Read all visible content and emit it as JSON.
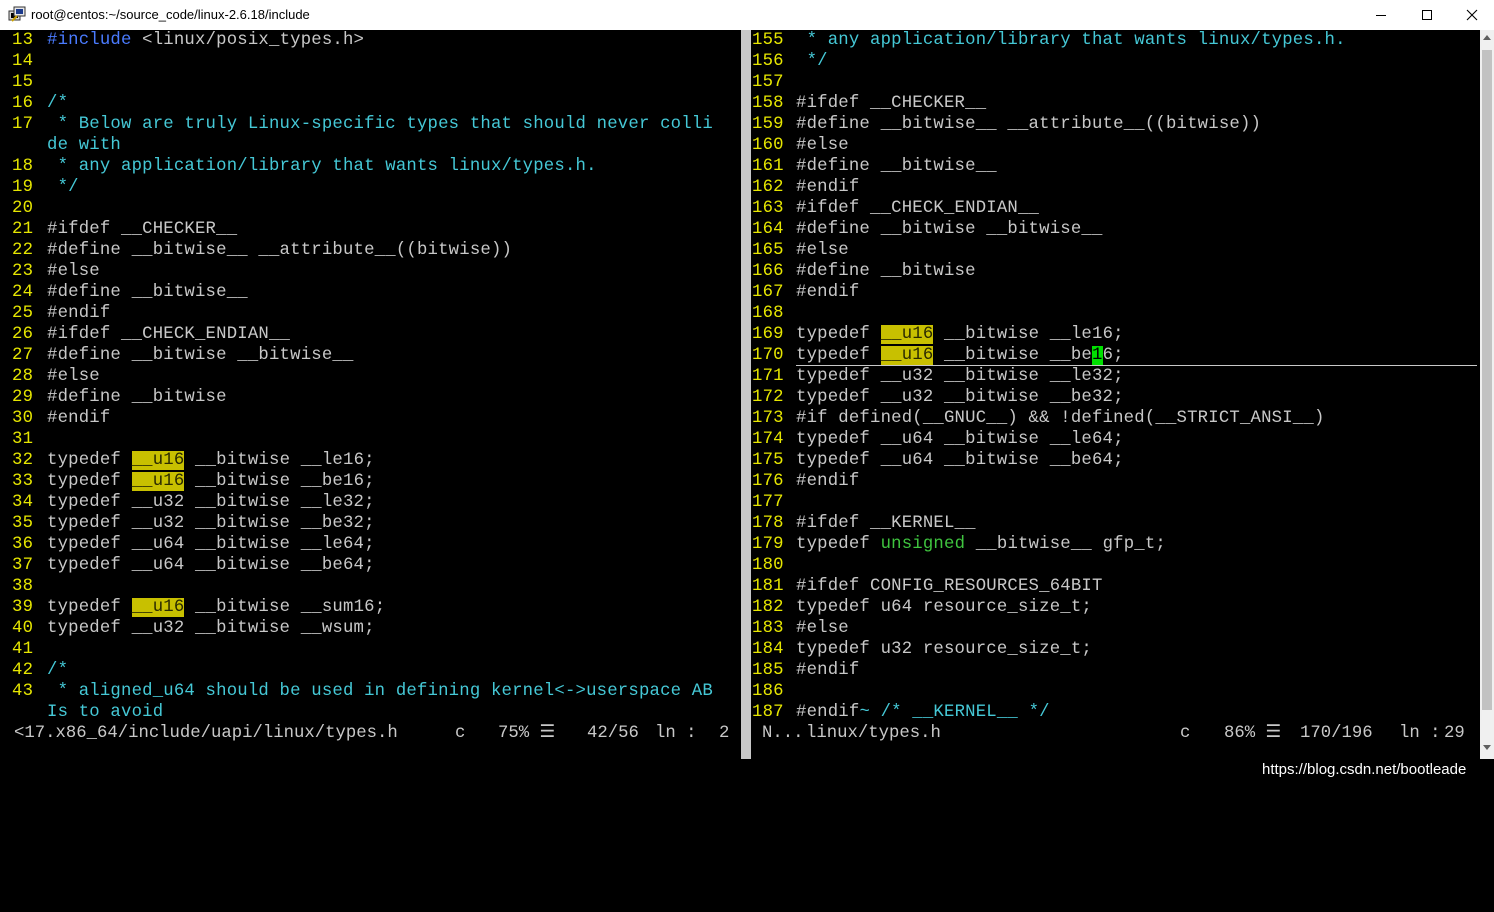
{
  "window": {
    "title": "root@centos:~/source_code/linux-2.6.18/include",
    "icons": [
      "putty-icon",
      "minimize-icon",
      "maximize-icon",
      "close-icon"
    ]
  },
  "left_pane": {
    "lines": [
      {
        "n": "13",
        "parts": [
          {
            "t": "#include",
            "c": "inc"
          },
          {
            "t": " <linux/posix_types.h>",
            "c": "norm"
          }
        ]
      },
      {
        "n": "14",
        "parts": []
      },
      {
        "n": "15",
        "parts": []
      },
      {
        "n": "16",
        "parts": [
          {
            "t": "/*",
            "c": "cmt"
          }
        ]
      },
      {
        "n": "17",
        "parts": [
          {
            "t": " * Below are truly Linux-specific types that should never colli",
            "c": "cmt"
          }
        ]
      },
      {
        "n": "",
        "parts": [
          {
            "t": "de with",
            "c": "cmt"
          }
        ]
      },
      {
        "n": "18",
        "parts": [
          {
            "t": " * any application/library that wants linux/types.h.",
            "c": "cmt"
          }
        ]
      },
      {
        "n": "19",
        "parts": [
          {
            "t": " */",
            "c": "cmt"
          }
        ]
      },
      {
        "n": "20",
        "parts": []
      },
      {
        "n": "21",
        "parts": [
          {
            "t": "#ifdef __CHECKER__",
            "c": "norm"
          }
        ]
      },
      {
        "n": "22",
        "parts": [
          {
            "t": "#define __bitwise__ __attribute__((bitwise))",
            "c": "norm"
          }
        ]
      },
      {
        "n": "23",
        "parts": [
          {
            "t": "#else",
            "c": "norm"
          }
        ]
      },
      {
        "n": "24",
        "parts": [
          {
            "t": "#define __bitwise__",
            "c": "norm"
          }
        ]
      },
      {
        "n": "25",
        "parts": [
          {
            "t": "#endif",
            "c": "norm"
          }
        ]
      },
      {
        "n": "26",
        "parts": [
          {
            "t": "#ifdef __CHECK_ENDIAN__",
            "c": "norm"
          }
        ]
      },
      {
        "n": "27",
        "parts": [
          {
            "t": "#define __bitwise __bitwise__",
            "c": "norm"
          }
        ]
      },
      {
        "n": "28",
        "parts": [
          {
            "t": "#else",
            "c": "norm"
          }
        ]
      },
      {
        "n": "29",
        "parts": [
          {
            "t": "#define __bitwise",
            "c": "norm"
          }
        ]
      },
      {
        "n": "30",
        "parts": [
          {
            "t": "#endif",
            "c": "norm"
          }
        ]
      },
      {
        "n": "31",
        "parts": []
      },
      {
        "n": "32",
        "parts": [
          {
            "t": "typedef ",
            "c": "norm"
          },
          {
            "t": "__u16",
            "c": "hl"
          },
          {
            "t": " __bitwise __le16;",
            "c": "norm"
          }
        ]
      },
      {
        "n": "33",
        "parts": [
          {
            "t": "typedef ",
            "c": "norm"
          },
          {
            "t": "__u16",
            "c": "hl"
          },
          {
            "t": " __bitwise __be16;",
            "c": "norm"
          }
        ]
      },
      {
        "n": "34",
        "parts": [
          {
            "t": "typedef __u32 __bitwise __le32;",
            "c": "norm"
          }
        ]
      },
      {
        "n": "35",
        "parts": [
          {
            "t": "typedef __u32 __bitwise __be32;",
            "c": "norm"
          }
        ]
      },
      {
        "n": "36",
        "parts": [
          {
            "t": "typedef __u64 __bitwise __le64;",
            "c": "norm"
          }
        ]
      },
      {
        "n": "37",
        "parts": [
          {
            "t": "typedef __u64 __bitwise __be64;",
            "c": "norm"
          }
        ]
      },
      {
        "n": "38",
        "parts": []
      },
      {
        "n": "39",
        "parts": [
          {
            "t": "typedef ",
            "c": "norm"
          },
          {
            "t": "__u16",
            "c": "hl"
          },
          {
            "t": " __bitwise __sum16;",
            "c": "norm"
          }
        ]
      },
      {
        "n": "40",
        "parts": [
          {
            "t": "typedef __u32 __bitwise __wsum;",
            "c": "norm"
          }
        ]
      },
      {
        "n": "41",
        "parts": []
      },
      {
        "n": "42",
        "parts": [
          {
            "t": "/*",
            "c": "cmt"
          }
        ]
      },
      {
        "n": "43",
        "parts": [
          {
            "t": " * aligned_u64 should be used in defining kernel<->userspace AB",
            "c": "cmt"
          }
        ]
      },
      {
        "n": "",
        "parts": [
          {
            "t": "Is to avoid",
            "c": "cmt"
          }
        ]
      }
    ],
    "status": {
      "file": "<17.x86_64/include/uapi/linux/types.h",
      "filetype": "c",
      "percent": "75% ☰",
      "position": "42/56",
      "ln_label": "ln :",
      "col": "2"
    }
  },
  "right_pane": {
    "lines": [
      {
        "n": "155",
        "parts": [
          {
            "t": " * any application/library that wants linux/types.h.",
            "c": "cmt"
          }
        ]
      },
      {
        "n": "156",
        "parts": [
          {
            "t": " */",
            "c": "cmt"
          }
        ]
      },
      {
        "n": "157",
        "parts": []
      },
      {
        "n": "158",
        "parts": [
          {
            "t": "#ifdef __CHECKER__",
            "c": "norm"
          }
        ]
      },
      {
        "n": "159",
        "parts": [
          {
            "t": "#define __bitwise__ __attribute__((bitwise))",
            "c": "norm"
          }
        ]
      },
      {
        "n": "160",
        "parts": [
          {
            "t": "#else",
            "c": "norm"
          }
        ]
      },
      {
        "n": "161",
        "parts": [
          {
            "t": "#define __bitwise__",
            "c": "norm"
          }
        ]
      },
      {
        "n": "162",
        "parts": [
          {
            "t": "#endif",
            "c": "norm"
          }
        ]
      },
      {
        "n": "163",
        "parts": [
          {
            "t": "#ifdef __CHECK_ENDIAN__",
            "c": "norm"
          }
        ]
      },
      {
        "n": "164",
        "parts": [
          {
            "t": "#define __bitwise __bitwise__",
            "c": "norm"
          }
        ]
      },
      {
        "n": "165",
        "parts": [
          {
            "t": "#else",
            "c": "norm"
          }
        ]
      },
      {
        "n": "166",
        "parts": [
          {
            "t": "#define __bitwise",
            "c": "norm"
          }
        ]
      },
      {
        "n": "167",
        "parts": [
          {
            "t": "#endif",
            "c": "norm"
          }
        ]
      },
      {
        "n": "168",
        "parts": []
      },
      {
        "n": "169",
        "parts": [
          {
            "t": "typedef ",
            "c": "norm"
          },
          {
            "t": "__u16",
            "c": "hl"
          },
          {
            "t": " __bitwise __le16;",
            "c": "norm"
          }
        ]
      },
      {
        "n": "170",
        "parts": [
          {
            "t": "typedef ",
            "c": "norm"
          },
          {
            "t": "__u16",
            "c": "hl"
          },
          {
            "t": " __bitwise __be",
            "c": "norm"
          },
          {
            "t": "1",
            "c": "cur"
          },
          {
            "t": "6;",
            "c": "norm"
          }
        ]
      },
      {
        "n": "171",
        "parts": [
          {
            "t": "typedef __u32 __bitwise __le32;",
            "c": "norm"
          }
        ]
      },
      {
        "n": "172",
        "parts": [
          {
            "t": "typedef __u32 __bitwise __be32;",
            "c": "norm"
          }
        ]
      },
      {
        "n": "173",
        "parts": [
          {
            "t": "#if defined(__GNUC__) && !defined(__STRICT_ANSI__)",
            "c": "norm"
          }
        ]
      },
      {
        "n": "174",
        "parts": [
          {
            "t": "typedef __u64 __bitwise __le64;",
            "c": "norm"
          }
        ]
      },
      {
        "n": "175",
        "parts": [
          {
            "t": "typedef __u64 __bitwise __be64;",
            "c": "norm"
          }
        ]
      },
      {
        "n": "176",
        "parts": [
          {
            "t": "#endif",
            "c": "norm"
          }
        ]
      },
      {
        "n": "177",
        "parts": []
      },
      {
        "n": "178",
        "parts": [
          {
            "t": "#ifdef __KERNEL__",
            "c": "norm"
          }
        ]
      },
      {
        "n": "179",
        "parts": [
          {
            "t": "typedef ",
            "c": "norm"
          },
          {
            "t": "unsigned",
            "c": "type"
          },
          {
            "t": " __bitwise__ gfp_t;",
            "c": "norm"
          }
        ]
      },
      {
        "n": "180",
        "parts": []
      },
      {
        "n": "181",
        "parts": [
          {
            "t": "#ifdef CONFIG_RESOURCES_64BIT",
            "c": "norm"
          }
        ]
      },
      {
        "n": "182",
        "parts": [
          {
            "t": "typedef u64 resource_size_t;",
            "c": "norm"
          }
        ]
      },
      {
        "n": "183",
        "parts": [
          {
            "t": "#else",
            "c": "norm"
          }
        ]
      },
      {
        "n": "184",
        "parts": [
          {
            "t": "typedef u32 resource_size_t;",
            "c": "norm"
          }
        ]
      },
      {
        "n": "185",
        "parts": [
          {
            "t": "#endif",
            "c": "norm"
          }
        ]
      },
      {
        "n": "186",
        "parts": []
      },
      {
        "n": "187",
        "parts": [
          {
            "t": "#endif",
            "c": "norm"
          },
          {
            "t": "~ /* __KERNEL__ */",
            "c": "cmt"
          }
        ]
      }
    ],
    "status": {
      "mode": "N...",
      "file": "linux/types.h",
      "filetype": "c",
      "percent": "86% ☰",
      "position": "170/196",
      "ln_label": "ln :",
      "col": "29"
    }
  },
  "watermark": "https://blog.csdn.net/bootleade"
}
